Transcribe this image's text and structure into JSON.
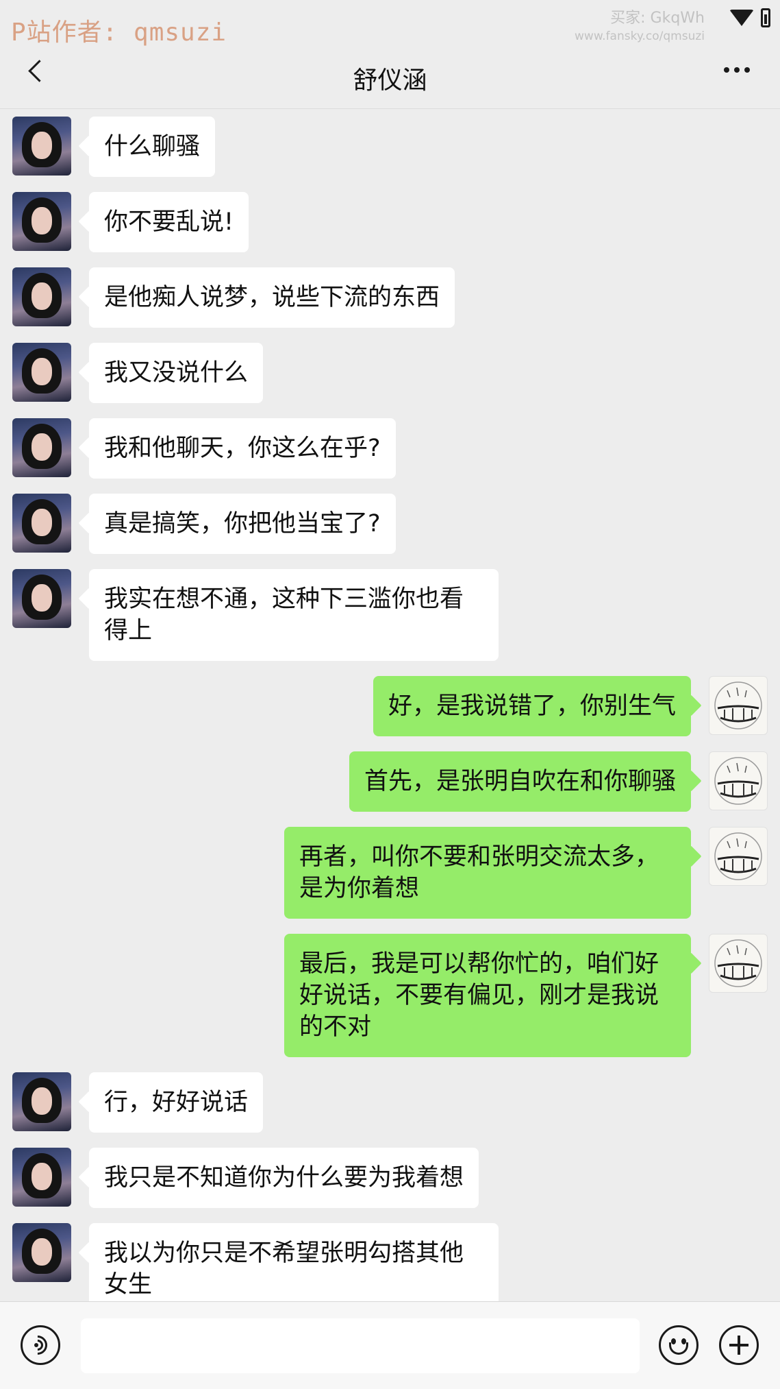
{
  "watermark": {
    "left_text": "P站作者: qmsuzi",
    "right_line1": "买家: GkqWh",
    "right_line2": "www.fansky.co/qmsuzi"
  },
  "header": {
    "title": "舒仪涵"
  },
  "messages": [
    {
      "sender": "other",
      "text": "什么聊骚"
    },
    {
      "sender": "other",
      "text": "你不要乱说!"
    },
    {
      "sender": "other",
      "text": "是他痴人说梦，说些下流的东西"
    },
    {
      "sender": "other",
      "text": "我又没说什么"
    },
    {
      "sender": "other",
      "text": "我和他聊天，你这么在乎?"
    },
    {
      "sender": "other",
      "text": "真是搞笑，你把他当宝了?"
    },
    {
      "sender": "other",
      "text": "我实在想不通，这种下三滥你也看得上"
    },
    {
      "sender": "self",
      "text": "好，是我说错了，你别生气"
    },
    {
      "sender": "self",
      "text": "首先，是张明自吹在和你聊骚"
    },
    {
      "sender": "self",
      "text": "再者，叫你不要和张明交流太多，是为你着想"
    },
    {
      "sender": "self",
      "text": "最后，我是可以帮你忙的，咱们好好说话，不要有偏见，刚才是我说的不对"
    },
    {
      "sender": "other",
      "text": "行，好好说话"
    },
    {
      "sender": "other",
      "text": "我只是不知道你为什么要为我着想"
    },
    {
      "sender": "other",
      "text": "我以为你只是不希望张明勾搭其他女生"
    }
  ],
  "colors": {
    "background": "#ededed",
    "self_bubble": "#95ec69",
    "other_bubble": "#ffffff"
  },
  "icons": {
    "back": "chevron-left-icon",
    "more": "more-dots-icon",
    "voice": "voice-icon",
    "emoji": "emoji-icon",
    "plus": "plus-icon"
  }
}
